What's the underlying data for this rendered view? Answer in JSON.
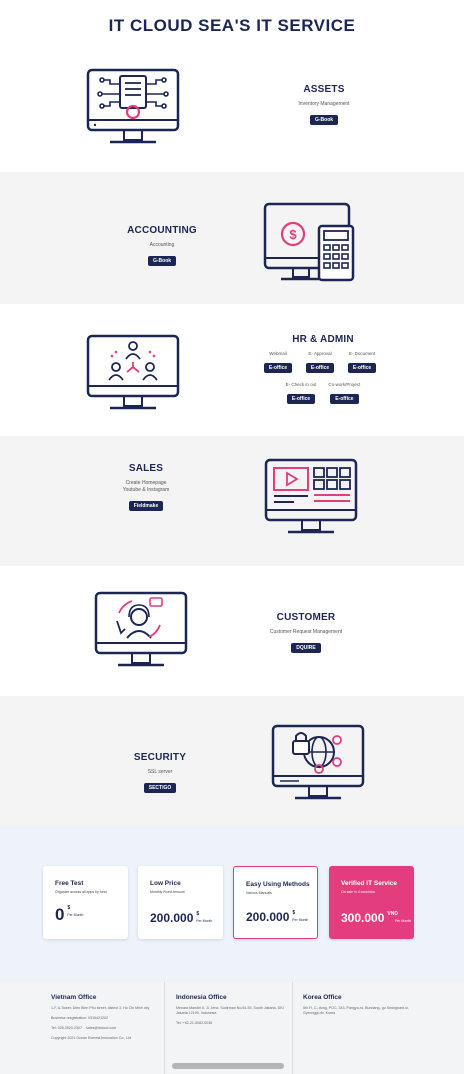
{
  "page_title": "IT CLOUD SEA'S IT SERVICE",
  "colors": {
    "navy": "#1c2654",
    "pink": "#e33d7e",
    "gray_bg": "#f4f4f4",
    "pricing_bg": "#eef3fb"
  },
  "services": {
    "assets": {
      "title": "ASSETS",
      "sub": "Inventory Management",
      "badge": "G-Book",
      "icon": "server-gear-monitor-icon"
    },
    "accounting": {
      "title": "ACCOUNTING",
      "sub": "Accounting",
      "badge": "G-Book",
      "icon": "dollar-calculator-monitor-icon"
    },
    "hr": {
      "title": "HR & ADMIN",
      "items": [
        {
          "label": "Webmail",
          "badge": "E-office"
        },
        {
          "label": "E- Approval",
          "badge": "E-office"
        },
        {
          "label": "E- Document",
          "badge": "E-office"
        },
        {
          "label": "E- Check in out",
          "badge": "E-office"
        },
        {
          "label": "Co-work/Project",
          "badge": "E-office"
        }
      ],
      "icon": "team-network-monitor-icon"
    },
    "sales": {
      "title": "SALES",
      "sub1": "Create Homepage",
      "sub2": "Youtube & Instagram",
      "badge": "Fieldmake",
      "icon": "video-grid-monitor-icon"
    },
    "customer": {
      "title": "CUSTOMER",
      "sub": "Customer Request Management",
      "badge": "DQUIRE",
      "icon": "support-agent-monitor-icon"
    },
    "security": {
      "title": "SECURITY",
      "sub": "SSL server",
      "badge": "SECTIGO",
      "icon": "lock-globe-monitor-icon"
    }
  },
  "pricing": [
    {
      "title": "Free Test",
      "sub": "Organize access all apps by fund",
      "price": "0",
      "currency": "$",
      "per": "Per Month"
    },
    {
      "title": "Low Price",
      "sub": "Monthly Fixed Amount",
      "price": "200.000",
      "currency": "$",
      "per": "Per Month"
    },
    {
      "title": "Easy Using Methods",
      "sub": "Various Manuals",
      "price": "200.000",
      "currency": "$",
      "per": "Per Month"
    },
    {
      "title": "Verified IT Service",
      "sub": "On sale in 4 countries",
      "price": "300.000",
      "currency": "VND",
      "per": "Per Month"
    }
  ],
  "footer": {
    "vietnam": {
      "title": "Vietnam Office",
      "address": "1-F, A-Tower, Dien Bien Phu street, district 3, Ho Chi Minh city",
      "reg": "Business resgistration: 0316421202",
      "tel": "Tel: 028-3520-2307",
      "email": "sales@itcloud.com",
      "copyright": "Copyright 2021 Ocean Everest Innovation Co., Ltd"
    },
    "indonesia": {
      "title": "Indonesia Office",
      "address": "Menara Mandiri II, Jl. Jend. Sudirman No.54-55, South Jakarta, DKI Jakarta 12190, Indonesia",
      "tel": "Tel: +62-21-5082-0038"
    },
    "korea": {
      "title": "Korea Office",
      "address": "5th Fl, C- dong, POC, 343, Pangyo-ro, Bundang- gu Seongnam-si, Gyeonggi-do, Korea"
    }
  }
}
